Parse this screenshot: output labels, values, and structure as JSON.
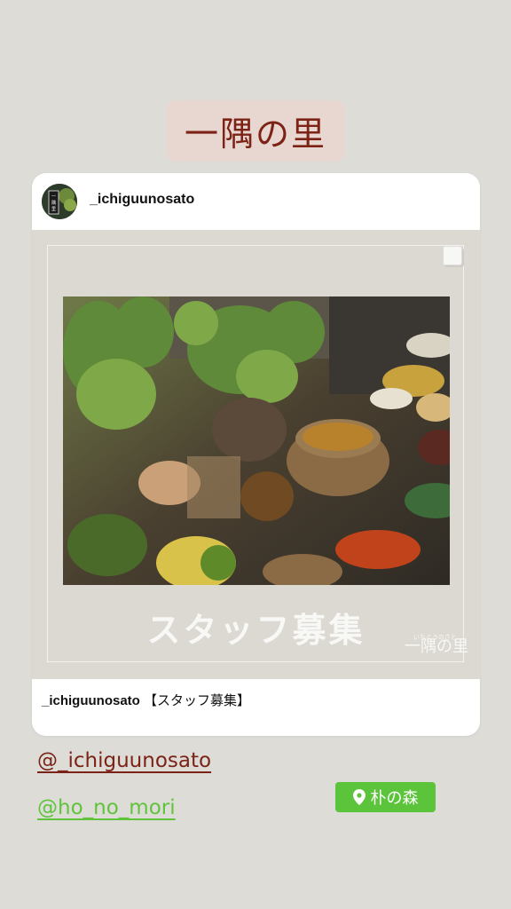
{
  "story": {
    "title_sticker": "一隅の里",
    "mentions": [
      "@_ichiguunosato",
      "@ho_no_mori"
    ],
    "location": {
      "label": "朴の森",
      "icon": "location-pin-icon"
    },
    "colors": {
      "title": "#7c2316",
      "mention_primary": "#7b2316",
      "mention_secondary": "#5fc43c",
      "location_bg": "#5cc43a"
    }
  },
  "post": {
    "username": "_ichiguunosato",
    "image_text": "スタッフ募集",
    "logo_text": "一隅の里",
    "logo_small": "いちぐうのさと",
    "caption_user": "_ichiguunosato",
    "caption_text": "【スタッフ募集】"
  }
}
